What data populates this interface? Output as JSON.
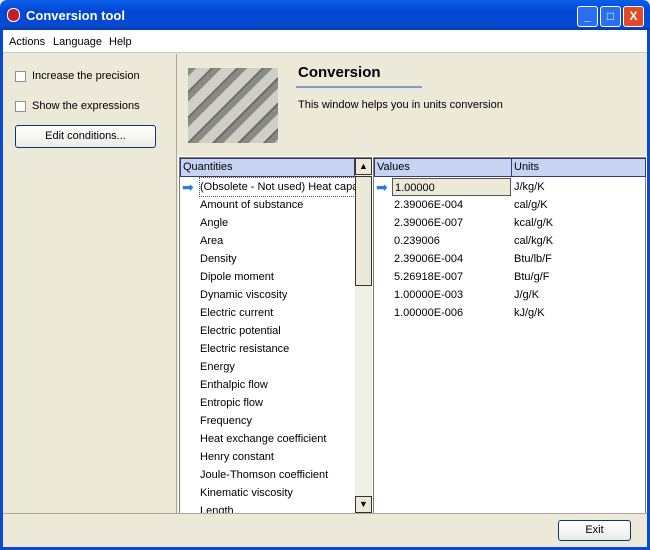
{
  "window": {
    "title": "Conversion tool",
    "minimize": "_",
    "maximize": "□",
    "close": "X"
  },
  "menu": [
    "Actions",
    "Language",
    "Help"
  ],
  "options": {
    "precision": "Increase the precision",
    "expressions": "Show the expressions",
    "precision_checked": false,
    "expressions_checked": false,
    "edit_button": "Edit conditions..."
  },
  "header": {
    "title": "Conversion",
    "description": "This window helps you in units conversion"
  },
  "quantities": {
    "header": "Quantities",
    "items": [
      "(Obsolete - Not used) Heat capa",
      "Amount of substance",
      "Angle",
      "Area",
      "Density",
      "Dipole moment",
      "Dynamic viscosity",
      "Electric current",
      "Electric potential",
      "Electric resistance",
      "Energy",
      "Enthalpic flow",
      "Entropic flow",
      "Frequency",
      "Heat exchange coefficient",
      "Henry constant",
      "Joule-Thomson coefficient",
      "Kinematic viscosity",
      "Length"
    ],
    "selected": 0
  },
  "values": {
    "header_values": "Values",
    "header_units": "Units",
    "rows": [
      {
        "value": "1.00000",
        "unit": "J/kg/K"
      },
      {
        "value": "2.39006E-004",
        "unit": "cal/g/K"
      },
      {
        "value": "2.39006E-007",
        "unit": "kcal/g/K"
      },
      {
        "value": "0.239006",
        "unit": "cal/kg/K"
      },
      {
        "value": "2.39006E-004",
        "unit": "Btu/lb/F"
      },
      {
        "value": "5.26918E-007",
        "unit": "Btu/g/F"
      },
      {
        "value": "1.00000E-003",
        "unit": "J/g/K"
      },
      {
        "value": "1.00000E-006",
        "unit": "kJ/g/K"
      }
    ]
  },
  "footer": {
    "exit": "Exit"
  }
}
